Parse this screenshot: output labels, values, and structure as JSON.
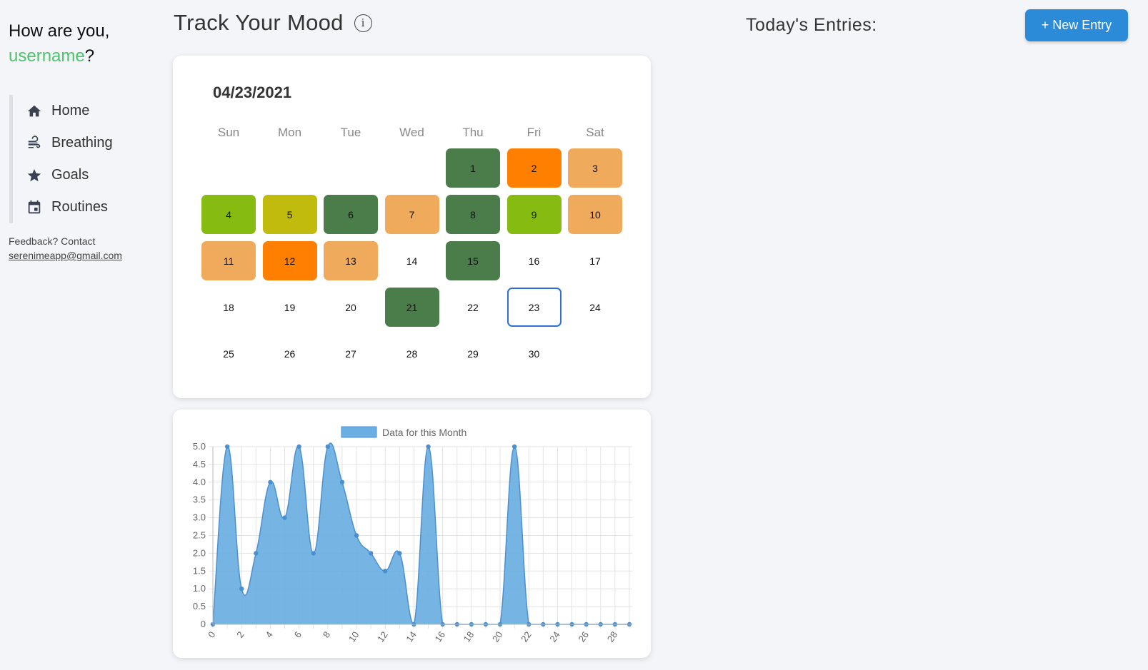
{
  "greeting": {
    "prefix": "How are you,",
    "username": "username",
    "suffix": "?"
  },
  "nav": [
    {
      "label": "Home",
      "icon": "home-icon"
    },
    {
      "label": "Breathing",
      "icon": "wind-icon"
    },
    {
      "label": "Goals",
      "icon": "star-icon"
    },
    {
      "label": "Routines",
      "icon": "calendar-icon"
    }
  ],
  "feedback": {
    "text": "Feedback? Contact",
    "email": "serenimeapp@gmail.com"
  },
  "header": {
    "title": "Track Your Mood",
    "info_icon": "i",
    "entries_title": "Today's Entries:",
    "new_entry_label": "+ New Entry"
  },
  "calendar": {
    "date": "04/23/2021",
    "weekdays": [
      "Sun",
      "Mon",
      "Tue",
      "Wed",
      "Thu",
      "Fri",
      "Sat"
    ],
    "first_weekday": 4,
    "days_in_month": 30,
    "selected_day": 23,
    "colors": {
      "dark_green": "#4a7d4a",
      "orange": "#ff7f00",
      "light_orange": "#f0aa5c",
      "lime": "#86bb12",
      "olive": "#c1bb0e",
      "selected_border": "#2e6fd1"
    },
    "moods": {
      "1": "dark_green",
      "2": "orange",
      "3": "light_orange",
      "4": "lime",
      "5": "olive",
      "6": "dark_green",
      "7": "light_orange",
      "8": "dark_green",
      "9": "lime",
      "10": "light_orange",
      "11": "light_orange",
      "12": "orange",
      "13": "light_orange",
      "15": "dark_green",
      "21": "dark_green"
    }
  },
  "chart_data": {
    "type": "area",
    "legend": "Data for this Month",
    "legend_position": "top",
    "color": "#6aaee2",
    "line_color": "#4a90d0",
    "x": [
      0,
      1,
      2,
      3,
      4,
      5,
      6,
      7,
      8,
      9,
      10,
      11,
      12,
      13,
      14,
      15,
      16,
      17,
      18,
      19,
      20,
      21,
      22,
      23,
      24,
      25,
      26,
      27,
      28,
      29
    ],
    "y": [
      0,
      5,
      1,
      2,
      4,
      3,
      5,
      2,
      5,
      4,
      2.5,
      2,
      1.5,
      2,
      0,
      5,
      0,
      0,
      0,
      0,
      0,
      5,
      0,
      0,
      0,
      0,
      0,
      0,
      0,
      0
    ],
    "ylim": [
      0,
      5
    ],
    "yticks": [
      "0",
      "0.5",
      "1.0",
      "1.5",
      "2.0",
      "2.5",
      "3.0",
      "3.5",
      "4.0",
      "4.5",
      "5.0"
    ],
    "xticks": [
      "0",
      "2",
      "4",
      "6",
      "8",
      "10",
      "12",
      "14",
      "16",
      "18",
      "20",
      "22",
      "24",
      "26",
      "28"
    ],
    "grid": true
  }
}
